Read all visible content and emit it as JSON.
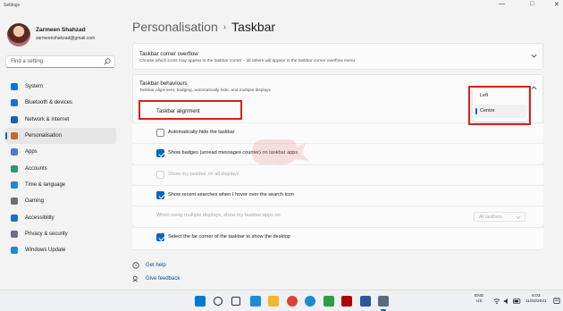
{
  "window": {
    "title": "Settings",
    "controls": [
      "—",
      "□",
      "✕"
    ]
  },
  "profile": {
    "name": "Zarmeen Shahzad",
    "email": "zarmeenshahzad@gmail.com"
  },
  "search": {
    "placeholder": "Find a setting"
  },
  "nav": {
    "items": [
      {
        "label": "System",
        "icon": "monitor-icon",
        "color": "#0078d4"
      },
      {
        "label": "Bluetooth & devices",
        "icon": "bluetooth-icon",
        "color": "#1b6fd0"
      },
      {
        "label": "Network & internet",
        "icon": "wifi-icon",
        "color": "#1f5fb8"
      },
      {
        "label": "Personalisation",
        "icon": "brush-icon",
        "color": "#c46a2c"
      },
      {
        "label": "Apps",
        "icon": "apps-icon",
        "color": "#4c7bd0"
      },
      {
        "label": "Accounts",
        "icon": "person-icon",
        "color": "#2b9a6c"
      },
      {
        "label": "Time & language",
        "icon": "globe-icon",
        "color": "#1d8ad6"
      },
      {
        "label": "Gaming",
        "icon": "gamepad-icon",
        "color": "#6e6e6e"
      },
      {
        "label": "Accessibility",
        "icon": "accessibility-icon",
        "color": "#1f6fc4"
      },
      {
        "label": "Privacy & security",
        "icon": "shield-icon",
        "color": "#6b7280"
      },
      {
        "label": "Windows Update",
        "icon": "update-icon",
        "color": "#1d8ad6"
      }
    ],
    "active_index": 3
  },
  "header": {
    "crumb": "Personalisation",
    "separator": "›",
    "title": "Taskbar"
  },
  "overflow_card": {
    "title": "Taskbar corner overflow",
    "subtitle": "Choose which icons may appear in the taskbar corner – all others will appear in the taskbar corner overflow menu"
  },
  "behaviours_card": {
    "title": "Taskbar behaviours",
    "subtitle": "Taskbar alignment, badging, automatically hide, and multiple displays",
    "alignment_label": "Taskbar alignment",
    "alignment_options": [
      "Left",
      "Centre"
    ],
    "alignment_selected": "Centre",
    "options": [
      {
        "label": "Automatically hide the taskbar",
        "checked": false,
        "enabled": true
      },
      {
        "label": "Show badges (unread messages counter) on taskbar apps",
        "checked": true,
        "enabled": true
      },
      {
        "label": "Show my taskbar on all displays",
        "checked": false,
        "enabled": false
      },
      {
        "label": "Show recent searches when I hover over the search icon",
        "checked": true,
        "enabled": true
      }
    ],
    "multi_display_label": "When using multiple displays, show my taskbar apps on",
    "multi_display_value": "All taskbars",
    "far_corner": {
      "label": "Select the far corner of the taskbar to show the desktop",
      "checked": true
    }
  },
  "help": {
    "get_help": "Get help",
    "give_feedback": "Give feedback"
  },
  "taskbar": {
    "icons": [
      {
        "name": "windows-start-icon",
        "color": "#0078d4"
      },
      {
        "name": "search-icon",
        "color": "#1a1a1a"
      },
      {
        "name": "task-view-icon",
        "color": "#333333"
      },
      {
        "name": "widgets-icon",
        "color": "#1f8ad6"
      },
      {
        "name": "file-explorer-icon",
        "color": "#f2b630"
      },
      {
        "name": "chrome-icon",
        "color": "#db4437"
      },
      {
        "name": "edge-icon",
        "color": "#1c8ad0"
      },
      {
        "name": "store-icon",
        "color": "#2f9e44"
      },
      {
        "name": "netflix-icon",
        "color": "#b00000"
      },
      {
        "name": "word-icon",
        "color": "#2b579a"
      },
      {
        "name": "settings-icon",
        "color": "#5a6b7d"
      }
    ],
    "tray": {
      "lang_top": "ENG",
      "lang_bottom": "US",
      "time": "6:03",
      "date": "11/02/2021"
    }
  }
}
